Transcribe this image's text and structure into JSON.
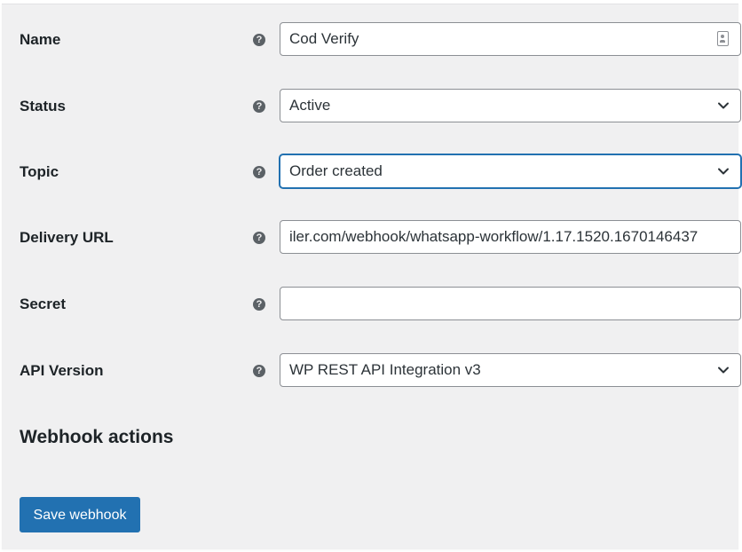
{
  "form": {
    "name": {
      "label": "Name",
      "help": "?",
      "value": "Cod Verify",
      "icon": "contact-card-icon"
    },
    "status": {
      "label": "Status",
      "help": "?",
      "value": "Active",
      "icon": "chevron-down-icon"
    },
    "topic": {
      "label": "Topic",
      "help": "?",
      "value": "Order created",
      "icon": "chevron-down-icon"
    },
    "delivery_url": {
      "label": "Delivery URL",
      "help": "?",
      "value": "iler.com/webhook/whatsapp-workflow/1.17.1520.1670146437"
    },
    "secret": {
      "label": "Secret",
      "help": "?",
      "value": ""
    },
    "api_version": {
      "label": "API Version",
      "help": "?",
      "value": "WP REST API Integration v3",
      "icon": "chevron-down-icon"
    }
  },
  "webhook_actions": {
    "title": "Webhook actions"
  },
  "save_button": {
    "label": "Save webhook"
  },
  "colors": {
    "accent": "#2271b1",
    "panel_bg": "#f0f0f1",
    "text": "#1d2327",
    "field_border": "#8c8f94"
  }
}
